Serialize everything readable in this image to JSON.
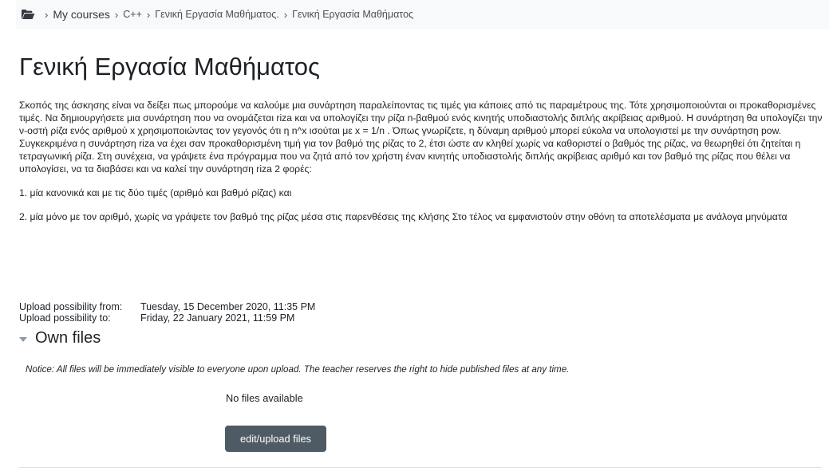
{
  "breadcrumb": {
    "folder_icon": "folder-open-icon",
    "separator": "›",
    "items": [
      "My courses",
      "C++",
      "Γενική Εργασία Μαθήματος.",
      "Γενική Εργασία Μαθήματος"
    ]
  },
  "page": {
    "title": "Γενική Εργασία Μαθήματος",
    "intro": [
      "Σκοπός της άσκησης είναι να δείξει πως μπορούμε να καλούμε μια συνάρτηση παραλείποντας τις τιμές για κάποιες από τις παραμέτρους της. Τότε χρησιμοποιούνται οι προκαθορισμένες τιμές. Να δημιουργήσετε μια συνάρτηση που να ονομάζεται riza και να υπολογίζει την ρίζα n-βαθμού ενός κινητής υποδιαστολής διπλής ακρίβειας αριθμού. Η συνάρτηση θα υπολογίζει την ν-οστή ρίζα ενός αριθμού x χρησιμοποιώντας τον γεγονός ότι η n^x ισούται με x = 1/n . Όπως γνωρίζετε, η δύναμη αριθμού μπορεί εύκολα να υπολογιστεί με την συνάρτηση pow. Συγκεκριμένα η συνάρτηση riza να έχει σαν προκαθορισμένη τιμή για τον βαθμό της ρίζας το 2, έτσι ώστε αν κληθεί χωρίς να καθοριστεί ο βαθμός της ρίζας, να θεωρηθεί ότι ζητείται η τετραγωνική ρίζα. Στη συνέχεια, να γράψετε ένα πρόγραμμα που να ζητά από τον χρήστη έναν κινητής υποδιαστολής διπλής ακρίβειας αριθμό και τον βαθμό της ρίζας που θέλει να υπολογίσει, να τα διαβάσει και να καλεί την συνάρτηση riza 2 φορές:",
      "1. μία κανονικά και με τις δύο τιμές (αριθμό και βαθμό ρίζας) και",
      "2. μία μόνο με τον αριθμό, χωρίς να γράψετε τον βαθμό της ρίζας μέσα στις παρενθέσεις της κλήσης Στο τέλος να εμφανιστούν στην οθόνη τα αποτελέσματα με ανάλογα μηνύματα"
    ]
  },
  "dates": {
    "from_label": "Upload possibility from:",
    "from_value": "Tuesday, 15 December 2020, 11:35 PM",
    "to_label": "Upload possibility to:",
    "to_value": "Friday, 22 January 2021, 11:59 PM"
  },
  "own_files": {
    "heading": "Own files",
    "toggle_icon": "caret-down-icon",
    "notice": "Notice: All files will be immediately visible to everyone upon upload. The teacher reserves the right to hide published files at any time.",
    "empty_text": "No files available",
    "button_label": "edit/upload files"
  },
  "colors": {
    "breadcrumb_bg": "#f8f9fa",
    "button_bg": "#4f5b64",
    "text": "#1d2125",
    "caret": "#8e9aa6"
  }
}
